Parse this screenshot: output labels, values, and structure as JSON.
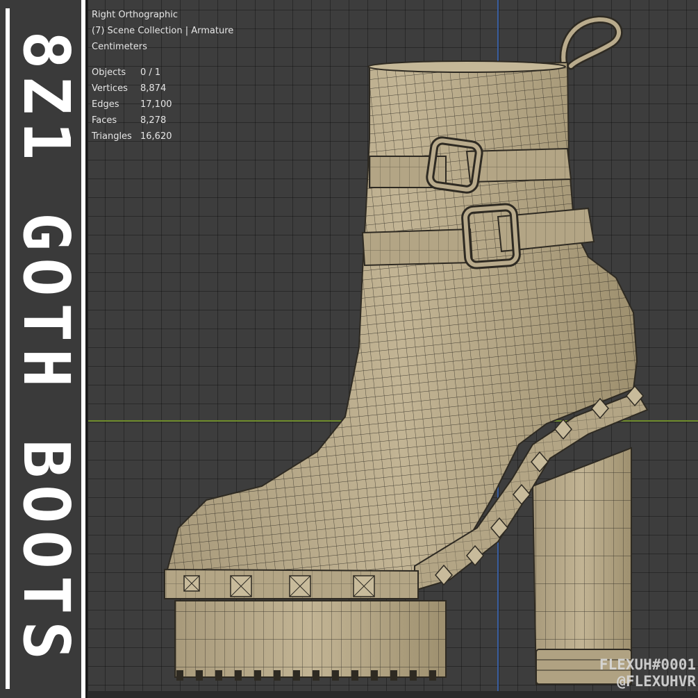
{
  "banner": {
    "title": "8Z1 GOTH BOOTS"
  },
  "viewport": {
    "view_name": "Right Orthographic",
    "collection": "(7) Scene Collection | Armature",
    "units": "Centimeters",
    "stats": [
      {
        "label": "Objects",
        "value": "0 / 1"
      },
      {
        "label": "Vertices",
        "value": "8,874"
      },
      {
        "label": "Edges",
        "value": "17,100"
      },
      {
        "label": "Faces",
        "value": "8,278"
      },
      {
        "label": "Triangles",
        "value": "16,620"
      }
    ]
  },
  "watermark": {
    "line1": "FLEXUH#0001",
    "line2": "@FLEXUHVR"
  },
  "colors": {
    "viewport_bg": "#3d3d3d",
    "mesh_fill": "#b9ab8c",
    "wire": "#2e2a22",
    "axis_x": "#6d8a2a",
    "axis_y": "#3b5fa0"
  }
}
